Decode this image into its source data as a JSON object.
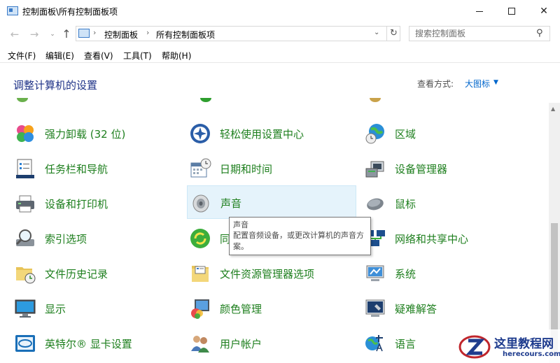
{
  "window": {
    "title": "控制面板\\所有控制面板项",
    "minimize_icon": "minimize-icon",
    "maximize_icon": "maximize-icon",
    "close_glyph": "✕"
  },
  "navigation": {
    "back_glyph": "←",
    "forward_glyph": "→",
    "recent_glyph": "⌄",
    "up_glyph": "↑",
    "breadcrumb": [
      "控制面板",
      "所有控制面板项"
    ],
    "breadcrumb_sep": "›",
    "dropdown_glyph": "⌄",
    "refresh_glyph": "↻",
    "search_placeholder": "搜索控制面板",
    "search_value": "",
    "search_glyph": "⚲"
  },
  "menu": [
    "文件(F)",
    "编辑(E)",
    "查看(V)",
    "工具(T)",
    "帮助(H)"
  ],
  "header": {
    "title": "调整计算机的设置",
    "view_by_label": "查看方式:",
    "view_by_value": "大图标",
    "view_by_arrow": "▼"
  },
  "items": [
    {
      "label": "强力卸载 (32 位)",
      "icon": "clover-icon"
    },
    {
      "label": "轻松使用设置中心",
      "icon": "ease-of-access-icon"
    },
    {
      "label": "区域",
      "icon": "globe-clock-icon"
    },
    {
      "label": "任务栏和导航",
      "icon": "taskbar-icon"
    },
    {
      "label": "日期和时间",
      "icon": "calendar-clock-icon"
    },
    {
      "label": "设备管理器",
      "icon": "device-manager-icon"
    },
    {
      "label": "设备和打印机",
      "icon": "printer-icon"
    },
    {
      "label": "声音",
      "icon": "speaker-icon"
    },
    {
      "label": "鼠标",
      "icon": "mouse-icon"
    },
    {
      "label": "索引选项",
      "icon": "search-indexing-icon"
    },
    {
      "label": "同步中心",
      "icon": "sync-center-icon"
    },
    {
      "label": "网络和共享中心",
      "icon": "network-icon"
    },
    {
      "label": "文件历史记录",
      "icon": "file-history-icon"
    },
    {
      "label": "文件资源管理器选项",
      "icon": "folder-options-icon"
    },
    {
      "label": "系统",
      "icon": "system-icon"
    },
    {
      "label": "显示",
      "icon": "display-icon"
    },
    {
      "label": "颜色管理",
      "icon": "color-management-icon"
    },
    {
      "label": "疑难解答",
      "icon": "troubleshooting-icon"
    },
    {
      "label": "英特尔® 显卡设置",
      "icon": "intel-graphics-icon"
    },
    {
      "label": "用户帐户",
      "icon": "user-accounts-icon"
    },
    {
      "label": "语言",
      "icon": "language-icon"
    }
  ],
  "tooltip": {
    "title": "声音",
    "description": "配置音频设备，或更改计算机的声音方案。"
  },
  "watermark": {
    "name": "这里教程网",
    "url": "herecours.com"
  },
  "colors": {
    "link_green": "#1e7f1e",
    "title_blue": "#1e3287",
    "hover_bg": "#e5f3fb",
    "view_blue": "#0066cc"
  }
}
